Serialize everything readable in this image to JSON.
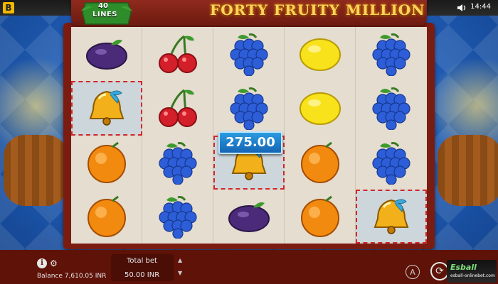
{
  "app": {
    "brand_letter": "B",
    "clock": "14:44"
  },
  "title": {
    "game_name": "FORTY FRUITY MILLION",
    "lines_count": "40",
    "lines_label": "LINES"
  },
  "reels": {
    "rows": [
      [
        "plum",
        "cherry",
        "grapes",
        "lemon",
        "grapes"
      ],
      [
        "bell",
        "cherry",
        "grapes",
        "lemon",
        "grapes"
      ],
      [
        "orange",
        "grapes",
        "bell",
        "orange",
        "grapes"
      ],
      [
        "orange",
        "grapes",
        "plum",
        "orange",
        "bell"
      ]
    ],
    "winning_cells": [
      [
        1,
        0
      ],
      [
        2,
        2
      ],
      [
        3,
        4
      ]
    ],
    "win_amount": "275.00"
  },
  "footer": {
    "balance_label": "Balance",
    "balance_value": "7,610.05 INR",
    "total_bet_label": "Total bet",
    "total_bet_value": "50.00 INR",
    "info_glyph": "i",
    "auto_glyph": "A",
    "logo_text": "Esball",
    "logo_subtext": "esball-onlinebet.com"
  },
  "icons": [
    "info-icon",
    "gear-icon",
    "speaker-icon",
    "spin-icon",
    "autoplay-icon",
    "bet-up-icon",
    "bet-down-icon"
  ],
  "colors": {
    "frame": "#7a1c12",
    "reel_bg": "#e4ddd0",
    "win_border": "#d32727",
    "title_gold": "#ffd35a",
    "footer": "#5e1208"
  }
}
